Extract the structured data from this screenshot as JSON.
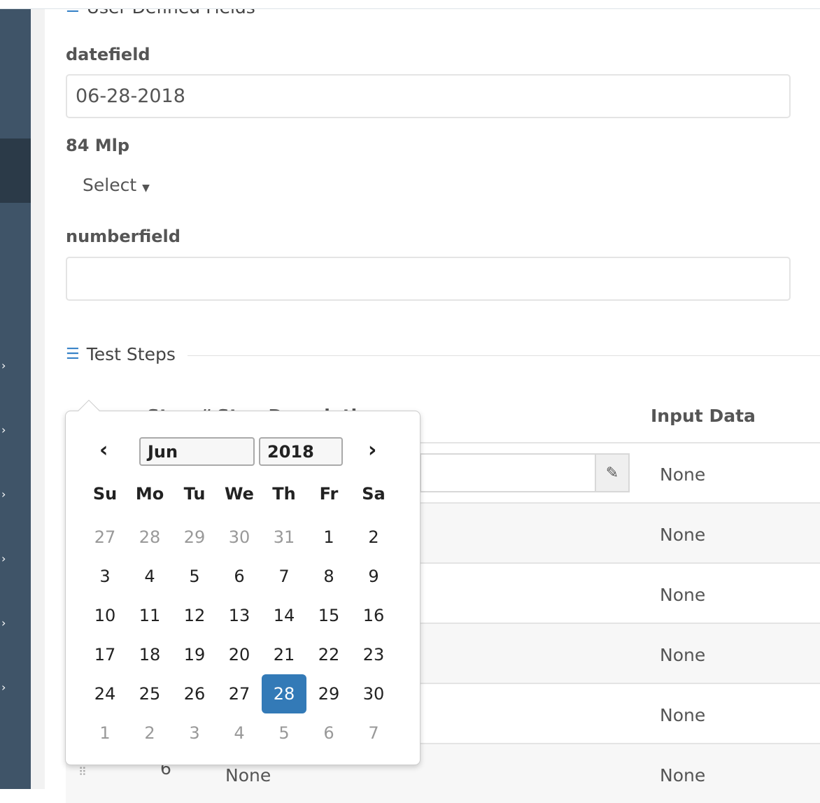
{
  "section_user_defined": {
    "title": "User Defined Fields",
    "icon": "sliders-icon"
  },
  "fields": [
    {
      "label": "datefield",
      "value": "06-28-2018"
    },
    {
      "label": "84 Mlp",
      "select_label": "Select"
    },
    {
      "label": "numberfield",
      "value": ""
    }
  ],
  "section_test_steps": {
    "title": "Test Steps",
    "icon": "list-icon"
  },
  "table": {
    "headers": {
      "step_num": "Step #",
      "step_desc": "Step Description",
      "input_data": "Input Data"
    },
    "rows": [
      {
        "input_data": "None"
      },
      {
        "input_data": "None"
      },
      {
        "input_data": "None"
      },
      {
        "input_data": "None"
      },
      {
        "input_data": "None"
      },
      {
        "step": "6",
        "desc": "None",
        "input_data": "None"
      }
    ]
  },
  "datepicker": {
    "month": "Jun",
    "year": "2018",
    "weekdays": [
      "Su",
      "Mo",
      "Tu",
      "We",
      "Th",
      "Fr",
      "Sa"
    ],
    "days": [
      [
        "27",
        "28",
        "29",
        "30",
        "31",
        "1",
        "2"
      ],
      [
        "3",
        "4",
        "5",
        "6",
        "7",
        "8",
        "9"
      ],
      [
        "10",
        "11",
        "12",
        "13",
        "14",
        "15",
        "16"
      ],
      [
        "17",
        "18",
        "19",
        "20",
        "21",
        "22",
        "23"
      ],
      [
        "24",
        "25",
        "26",
        "27",
        "28",
        "29",
        "30"
      ],
      [
        "1",
        "2",
        "3",
        "4",
        "5",
        "6",
        "7"
      ]
    ],
    "selected": "28",
    "accent": "#337ab7"
  },
  "colors": {
    "sidebar": "#3f5468",
    "sidebar_active": "#2b3a48"
  }
}
